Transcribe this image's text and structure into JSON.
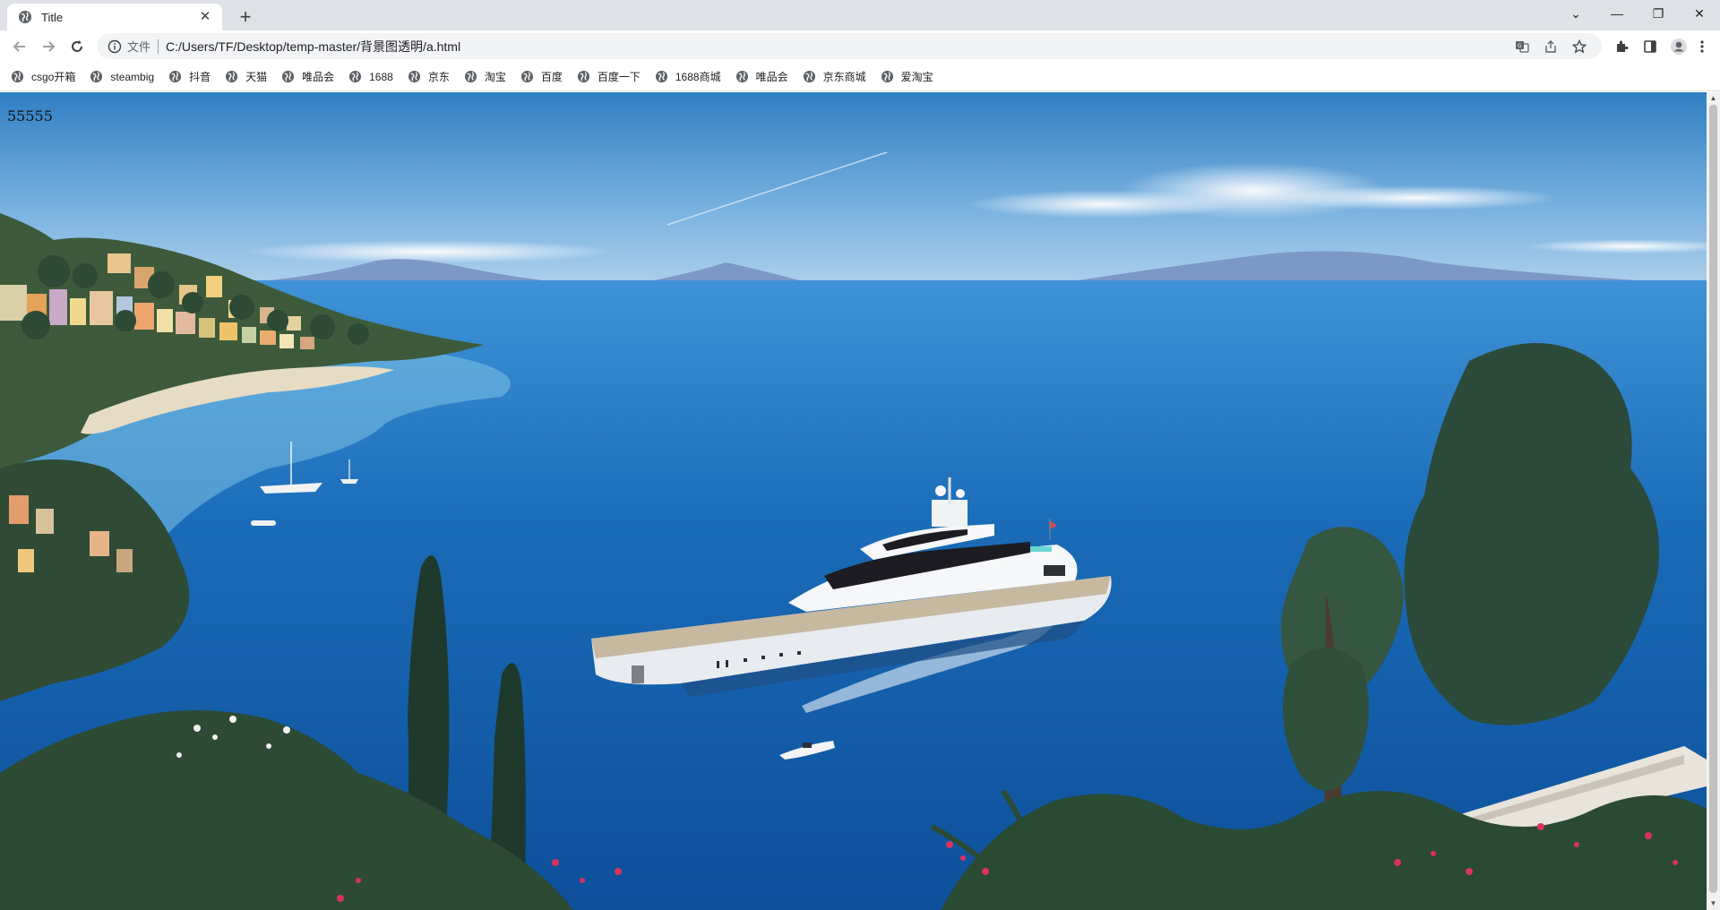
{
  "browser": {
    "tab": {
      "title": "Title",
      "close": "✕"
    },
    "new_tab": "+",
    "window_controls": {
      "tab_search": "⌄",
      "minimize": "—",
      "restore": "❐",
      "close": "✕"
    },
    "toolbar": {
      "back_icon": "arrow-left-icon",
      "forward_icon": "arrow-right-icon",
      "reload_icon": "reload-icon",
      "security_chip": "文件",
      "url": "C:/Users/TF/Desktop/temp-master/背景图透明/a.html",
      "right_icons": [
        "translate-icon",
        "share-icon",
        "star-icon",
        "extensions-icon",
        "side-panel-icon",
        "profile-icon",
        "menu-icon"
      ]
    },
    "bookmarks": [
      {
        "label": "csgo开箱"
      },
      {
        "label": "steambig"
      },
      {
        "label": "抖音"
      },
      {
        "label": "天猫"
      },
      {
        "label": "唯品会"
      },
      {
        "label": "1688"
      },
      {
        "label": "京东"
      },
      {
        "label": "淘宝"
      },
      {
        "label": "百度"
      },
      {
        "label": "百度一下"
      },
      {
        "label": "1688商城"
      },
      {
        "label": "唯品会"
      },
      {
        "label": "京东商城"
      },
      {
        "label": "爱淘宝"
      }
    ]
  },
  "page": {
    "text": "55555",
    "background": "illustration of a yacht in a Mediterranean bay",
    "colors": {
      "sky_top": "#2f7fc4",
      "sky_horizon": "#bcd8ee",
      "sea_deep": "#0d4f9a",
      "sea_light": "#3f93d6",
      "shallow": "#7cc3e8",
      "foliage": "#2c4a34"
    }
  }
}
